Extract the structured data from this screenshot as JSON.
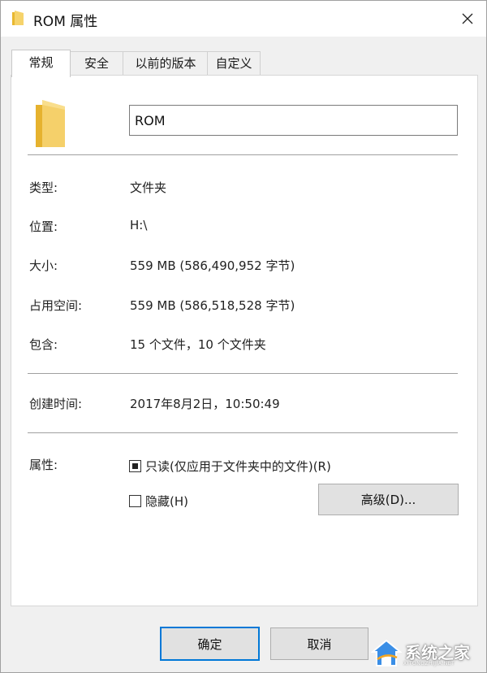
{
  "window": {
    "title": "ROM 属性",
    "close_icon": "close-icon"
  },
  "tabs": [
    {
      "label": "常规",
      "active": true
    },
    {
      "label": "安全",
      "active": false
    },
    {
      "label": "以前的版本",
      "active": false
    },
    {
      "label": "自定义",
      "active": false
    }
  ],
  "general": {
    "folder_icon": "folder-icon",
    "name_value": "ROM",
    "properties": [
      {
        "label": "类型:",
        "value": "文件夹"
      },
      {
        "label": "位置:",
        "value": "H:\\"
      },
      {
        "label": "大小:",
        "value": "559 MB (586,490,952 字节)"
      },
      {
        "label": "占用空间:",
        "value": "559 MB (586,518,528 字节)"
      },
      {
        "label": "包含:",
        "value": "15 个文件，10 个文件夹"
      }
    ],
    "created": {
      "label": "创建时间:",
      "value": "2017年8月2日，10:50:49"
    },
    "attributes": {
      "label": "属性:",
      "readonly_label": "只读(仅应用于文件夹中的文件)(R)",
      "readonly_state": "indeterminate",
      "hidden_label": "隐藏(H)",
      "hidden_state": "unchecked",
      "advanced_label": "高级(D)..."
    }
  },
  "footer": {
    "ok_label": "确定",
    "cancel_label": "取消"
  },
  "watermark": {
    "text": "系统之家",
    "url": "XITONGZHIJIA.NET"
  },
  "colors": {
    "folder": "#f2c94c",
    "default_button_border": "#0078d7"
  }
}
